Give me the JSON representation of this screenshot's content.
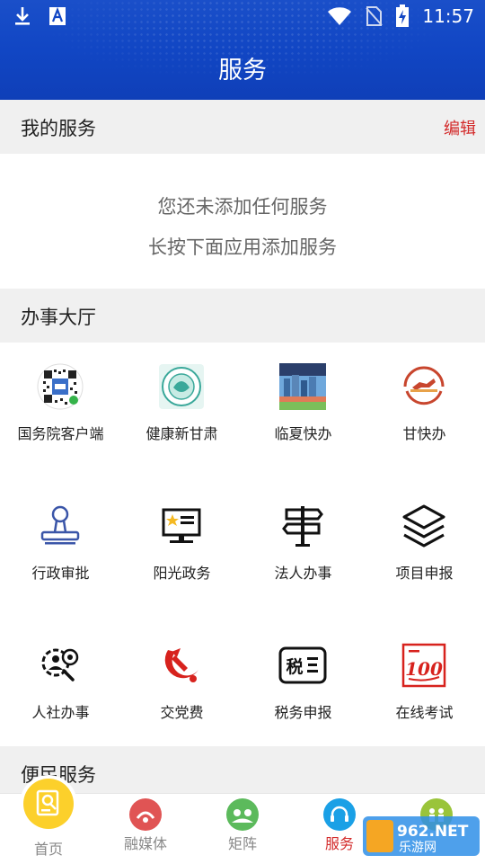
{
  "header": {
    "title": "服务",
    "time": "11:57"
  },
  "my_services": {
    "label": "我的服务",
    "edit_label": "编辑",
    "empty_line1": "您还未添加任何服务",
    "empty_line2": "长按下面应用添加服务"
  },
  "office": {
    "label": "办事大厅",
    "items": [
      {
        "label": "国务院客户端",
        "icon": "qr-code-icon"
      },
      {
        "label": "健康新甘肃",
        "icon": "health-gansu-logo-icon"
      },
      {
        "label": "临夏快办",
        "icon": "linxia-city-photo-icon"
      },
      {
        "label": "甘快办",
        "icon": "gankuaiban-logo-icon"
      },
      {
        "label": "行政审批",
        "icon": "stamp-icon"
      },
      {
        "label": "阳光政务",
        "icon": "monitor-star-icon"
      },
      {
        "label": "法人办事",
        "icon": "signpost-icon"
      },
      {
        "label": "项目申报",
        "icon": "layers-icon"
      },
      {
        "label": "人社办事",
        "icon": "person-gear-icon"
      },
      {
        "label": "交党费",
        "icon": "party-emblem-icon"
      },
      {
        "label": "税务申报",
        "icon": "tax-icon"
      },
      {
        "label": "在线考试",
        "icon": "exam-100-icon"
      }
    ]
  },
  "convenience": {
    "label": "便民服务"
  },
  "tax_glyph": "税",
  "exam_glyph": "100",
  "nav": {
    "items": [
      {
        "label": "首页",
        "color": "#fcd02b"
      },
      {
        "label": "融媒体",
        "color": "#e05454"
      },
      {
        "label": "矩阵",
        "color": "#5cba5c"
      },
      {
        "label": "服务",
        "color": "#1aa0e6"
      },
      {
        "label": "",
        "color": "#9ac43a"
      }
    ],
    "active_color": "#d32a2a"
  },
  "watermark": "962.NET 乐游网"
}
